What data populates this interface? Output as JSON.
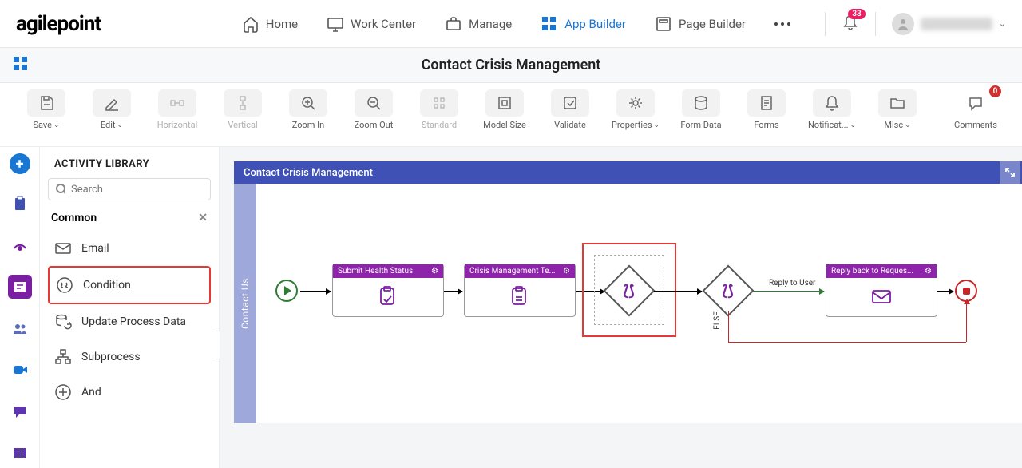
{
  "header": {
    "logo": "agilepoint",
    "nav": [
      {
        "icon": "house-icon",
        "label": "Home"
      },
      {
        "icon": "monitor-icon",
        "label": "Work Center"
      },
      {
        "icon": "briefcase-icon",
        "label": "Manage"
      },
      {
        "icon": "apps-icon",
        "label": "App Builder",
        "active": true
      },
      {
        "icon": "page-icon",
        "label": "Page Builder"
      }
    ],
    "notification_count": "33",
    "user_name": "••••••••"
  },
  "page_title": "Contact Crisis Management",
  "toolbar": {
    "save": "Save",
    "edit": "Edit",
    "horizontal": "Horizontal",
    "vertical": "Vertical",
    "zoom_in": "Zoom In",
    "zoom_out": "Zoom Out",
    "standard": "Standard",
    "model_size": "Model Size",
    "validate": "Validate",
    "properties": "Properties",
    "form_data": "Form Data",
    "forms": "Forms",
    "notifications": "Notificat...",
    "misc": "Misc",
    "comments": "Comments",
    "comment_count": "0"
  },
  "library": {
    "title": "ACTIVITY LIBRARY",
    "search_placeholder": "Search",
    "group": "Common",
    "items": [
      {
        "label": "Email"
      },
      {
        "label": "Condition",
        "highlight": true
      },
      {
        "label": "Update Process Data"
      },
      {
        "label": "Subprocess"
      },
      {
        "label": "And"
      }
    ]
  },
  "canvas": {
    "header": "Contact Crisis Management",
    "vtab": "Contact Us",
    "nodes": {
      "task1": "Submit Health Status",
      "task2": "Crisis Management Te...",
      "task3": "Reply back to Reques...",
      "reply_label": "Reply to User",
      "else_label": "ELSE"
    }
  }
}
